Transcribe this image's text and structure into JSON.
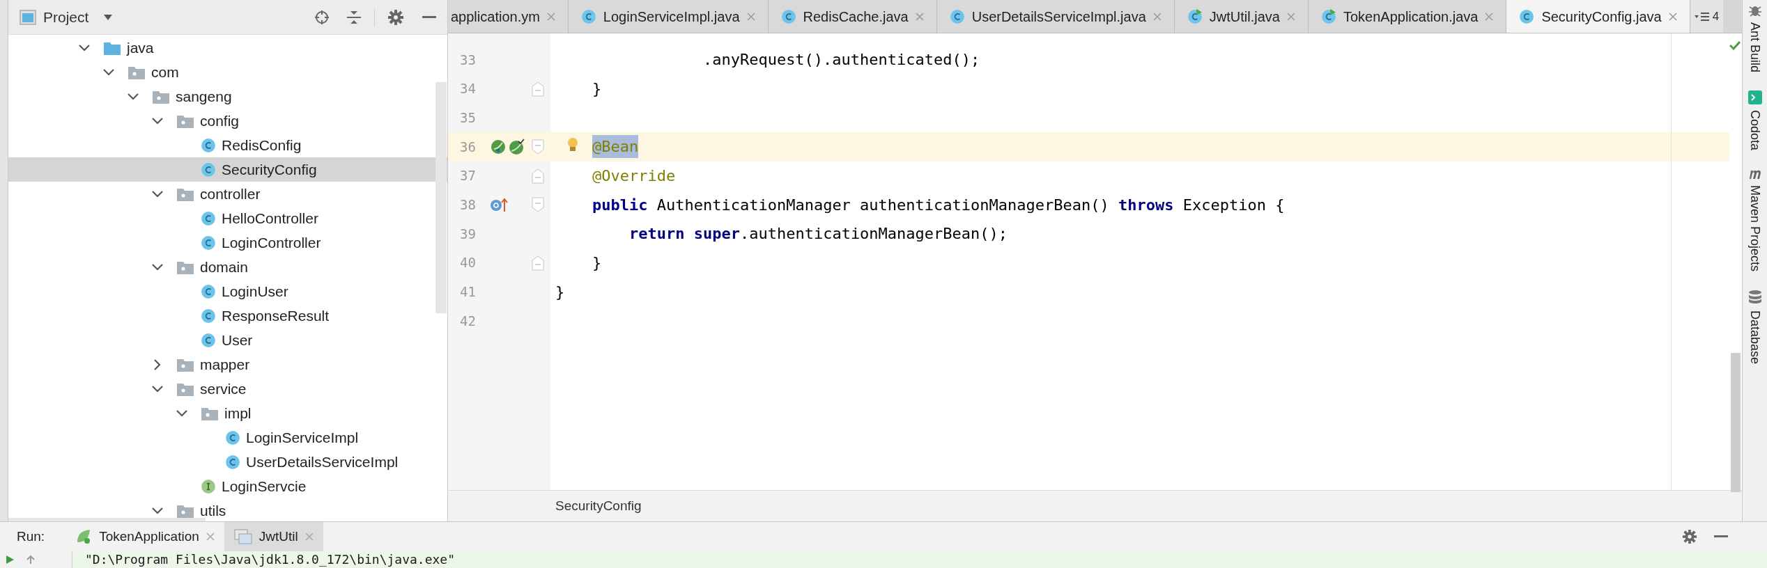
{
  "project_panel": {
    "title": "Project",
    "tree": [
      {
        "label": "java",
        "kind": "source_folder",
        "expanded": true,
        "selected": false,
        "children": [
          {
            "label": "com",
            "kind": "package",
            "expanded": true,
            "selected": false,
            "children": [
              {
                "label": "sangeng",
                "kind": "package",
                "expanded": true,
                "selected": false,
                "children": [
                  {
                    "label": "config",
                    "kind": "package",
                    "expanded": true,
                    "selected": false,
                    "children": [
                      {
                        "label": "RedisConfig",
                        "kind": "class",
                        "selected": false
                      },
                      {
                        "label": "SecurityConfig",
                        "kind": "class",
                        "selected": true
                      }
                    ]
                  },
                  {
                    "label": "controller",
                    "kind": "package",
                    "expanded": true,
                    "selected": false,
                    "children": [
                      {
                        "label": "HelloController",
                        "kind": "class",
                        "selected": false
                      },
                      {
                        "label": "LoginController",
                        "kind": "class",
                        "selected": false
                      }
                    ]
                  },
                  {
                    "label": "domain",
                    "kind": "package",
                    "expanded": true,
                    "selected": false,
                    "children": [
                      {
                        "label": "LoginUser",
                        "kind": "class",
                        "selected": false
                      },
                      {
                        "label": "ResponseResult",
                        "kind": "class",
                        "selected": false
                      },
                      {
                        "label": "User",
                        "kind": "class",
                        "selected": false
                      }
                    ]
                  },
                  {
                    "label": "mapper",
                    "kind": "package",
                    "expanded": false,
                    "selected": false
                  },
                  {
                    "label": "service",
                    "kind": "package",
                    "expanded": true,
                    "selected": false,
                    "children": [
                      {
                        "label": "impl",
                        "kind": "package",
                        "expanded": true,
                        "selected": false,
                        "children": [
                          {
                            "label": "LoginServiceImpl",
                            "kind": "class",
                            "selected": false
                          },
                          {
                            "label": "UserDetailsServiceImpl",
                            "kind": "class",
                            "selected": false
                          }
                        ]
                      },
                      {
                        "label": "LoginServcie",
                        "kind": "interface",
                        "selected": false
                      }
                    ]
                  },
                  {
                    "label": "utils",
                    "kind": "package",
                    "expanded": true,
                    "selected": false
                  }
                ]
              }
            ]
          }
        ]
      }
    ]
  },
  "editor": {
    "tabs": [
      {
        "label": "application.ym",
        "kind": "plain",
        "selected": false
      },
      {
        "label": "LoginServiceImpl.java",
        "kind": "class",
        "selected": false
      },
      {
        "label": "RedisCache.java",
        "kind": "class",
        "selected": false
      },
      {
        "label": "UserDetailsServiceImpl.java",
        "kind": "class",
        "selected": false
      },
      {
        "label": "JwtUtil.java",
        "kind": "run_class",
        "selected": false
      },
      {
        "label": "TokenApplication.java",
        "kind": "run_class",
        "selected": false
      },
      {
        "label": "SecurityConfig.java",
        "kind": "class",
        "selected": true
      }
    ],
    "overflow_count": "4",
    "lines": [
      {
        "number": "33",
        "current": false,
        "bulb": false,
        "tokens": [
          {
            "text": "                .anyRequest().authenticated();",
            "kind": "plain",
            "selected": false
          }
        ]
      },
      {
        "number": "34",
        "current": false,
        "bulb": false,
        "fold": {
          "kind": "end"
        },
        "tokens": [
          {
            "text": "    }",
            "kind": "plain",
            "selected": false
          }
        ]
      },
      {
        "number": "35",
        "current": false,
        "bulb": false
      },
      {
        "number": "36",
        "current": true,
        "bulb": true,
        "fold": {
          "kind": "start"
        },
        "markers": [
          {
            "kind": "bean_navigate"
          },
          {
            "kind": "bean_check"
          }
        ],
        "tokens": [
          {
            "text": "    @Bean",
            "kind": "annotation",
            "selected": true
          }
        ]
      },
      {
        "number": "37",
        "current": false,
        "bulb": false,
        "fold": {
          "kind": "end"
        },
        "tokens": [
          {
            "text": "    @Override",
            "kind": "annotation",
            "selected": false
          }
        ]
      },
      {
        "number": "38",
        "current": false,
        "bulb": false,
        "fold": {
          "kind": "start"
        },
        "markers": [
          {
            "kind": "override"
          }
        ],
        "tokens": [
          {
            "text": "    public",
            "kind": "keyword",
            "selected": false
          },
          {
            "text": " AuthenticationManager authenticationManagerBean() ",
            "kind": "plain",
            "selected": false
          },
          {
            "text": "throws",
            "kind": "keyword",
            "selected": false
          },
          {
            "text": " Exception {",
            "kind": "plain",
            "selected": false
          }
        ]
      },
      {
        "number": "39",
        "current": false,
        "bulb": false,
        "tokens": [
          {
            "text": "        return",
            "kind": "keyword",
            "selected": false
          },
          {
            "text": " super",
            "kind": "keyword",
            "selected": false
          },
          {
            "text": ".authenticationManagerBean();",
            "kind": "plain",
            "selected": false
          }
        ]
      },
      {
        "number": "40",
        "current": false,
        "bulb": false,
        "fold": {
          "kind": "end"
        },
        "tokens": [
          {
            "text": "    }",
            "kind": "plain",
            "selected": false
          }
        ]
      },
      {
        "number": "41",
        "current": false,
        "bulb": false,
        "tokens": [
          {
            "text": "}",
            "kind": "plain",
            "selected": false
          }
        ]
      },
      {
        "number": "42",
        "current": false,
        "bulb": false
      }
    ],
    "breadcrumb": "SecurityConfig"
  },
  "right_toolbar": [
    {
      "label": "Ant Build",
      "kind": "ant"
    },
    {
      "label": "Codota",
      "kind": "codota"
    },
    {
      "label": "Maven Projects",
      "kind": "maven"
    },
    {
      "label": "Database",
      "kind": "database"
    }
  ],
  "run_panel": {
    "label": "Run:",
    "tabs": [
      {
        "label": "TokenApplication",
        "kind": "run_app",
        "selected": false
      },
      {
        "label": "JwtUtil",
        "kind": "window",
        "selected": true
      }
    ],
    "console": [
      "\"D:\\Program Files\\Java\\jdk1.8.0_172\\bin\\java.exe\""
    ]
  }
}
